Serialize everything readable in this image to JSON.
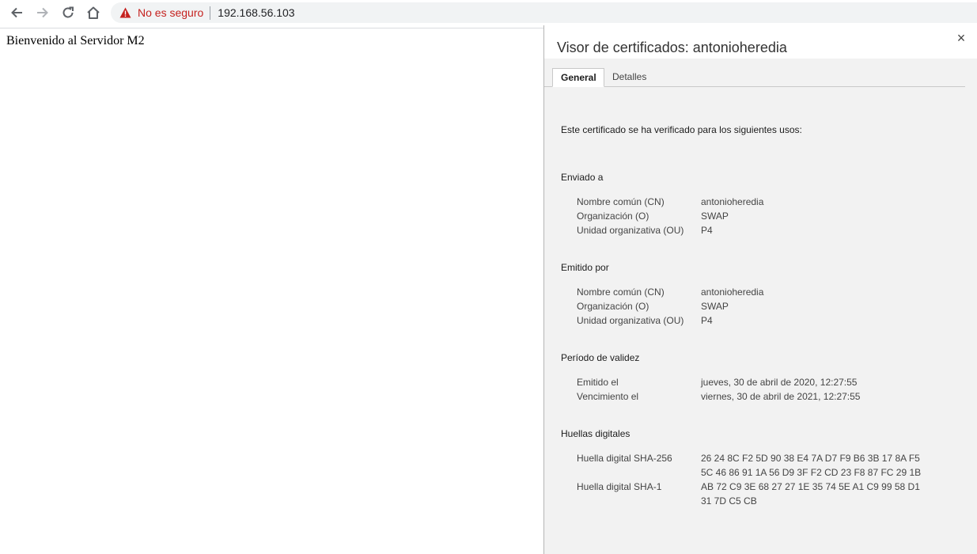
{
  "browser": {
    "back_icon": "arrow-left-icon",
    "forward_icon": "arrow-right-icon",
    "reload_icon": "reload-icon",
    "home_icon": "home-icon",
    "security_icon": "warning-triangle-icon",
    "security_text": "No es seguro",
    "url": "192.168.56.103",
    "security_color": "#c5221f"
  },
  "page": {
    "text": "Bienvenido al Servidor M2"
  },
  "dialog": {
    "title": "Visor de certificados: antonioheredia",
    "close_icon": "close-icon",
    "close_glyph": "×",
    "tabs": [
      {
        "label": "General",
        "active": true
      },
      {
        "label": "Detalles",
        "active": false
      }
    ],
    "intro": "Este certificado se ha verificado para los siguientes usos:",
    "issued_to": {
      "heading": "Enviado a",
      "fields": [
        {
          "label": "Nombre común (CN)",
          "value": "antonioheredia"
        },
        {
          "label": "Organización (O)",
          "value": "SWAP"
        },
        {
          "label": "Unidad organizativa (OU)",
          "value": "P4"
        }
      ]
    },
    "issued_by": {
      "heading": "Emitido por",
      "fields": [
        {
          "label": "Nombre común (CN)",
          "value": "antonioheredia"
        },
        {
          "label": "Organización (O)",
          "value": "SWAP"
        },
        {
          "label": "Unidad organizativa (OU)",
          "value": "P4"
        }
      ]
    },
    "validity": {
      "heading": "Período de validez",
      "fields": [
        {
          "label": "Emitido el",
          "value": "jueves, 30 de abril de 2020, 12:27:55"
        },
        {
          "label": "Vencimiento el",
          "value": "viernes, 30 de abril de 2021, 12:27:55"
        }
      ]
    },
    "fingerprints": {
      "heading": "Huellas digitales",
      "fields": [
        {
          "label": "Huella digital SHA-256",
          "value_line1": "26 24 8C F2 5D 90 38 E4 7A D7 F9 B6 3B 17 8A F5",
          "value_line2": "5C 46 86 91 1A 56 D9 3F F2 CD 23 F8 87 FC 29 1B"
        },
        {
          "label": "Huella digital SHA-1",
          "value_line1": "AB 72 C9 3E 68 27 27 1E 35 74 5E A1 C9 99 58 D1",
          "value_line2": "31 7D C5 CB"
        }
      ]
    }
  }
}
